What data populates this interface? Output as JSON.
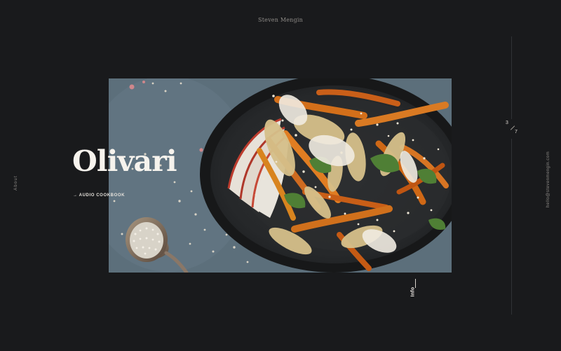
{
  "header": {
    "site_name": "Steven Mengin"
  },
  "left_nav": {
    "about": "About"
  },
  "right_rail": {
    "counter_current": "3",
    "counter_total": "7",
    "email": "hello@stevenmengin.com"
  },
  "project": {
    "title": "Olivari",
    "subtitle": "→ AUDIO COOKBOOK",
    "info_label": "Info"
  },
  "colors": {
    "background": "#191a1c",
    "text": "#f6f3ed",
    "muted": "#8f8c88"
  }
}
